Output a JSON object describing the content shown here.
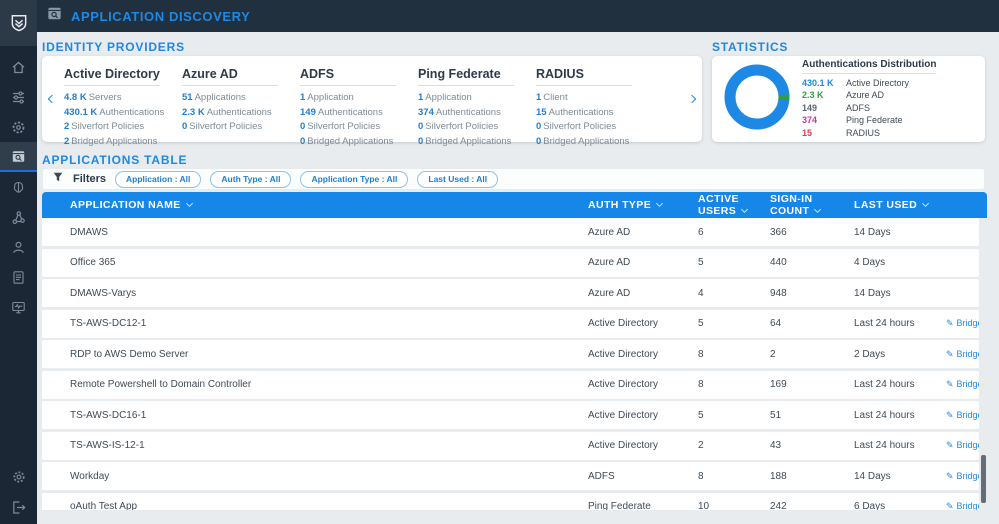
{
  "topbar": {
    "title": "APPLICATION DISCOVERY"
  },
  "sidebar": {
    "items": [
      {
        "icon": "home-icon"
      },
      {
        "icon": "policies-sliders-icon"
      },
      {
        "icon": "sync-gear-icon"
      },
      {
        "icon": "application-discovery-icon",
        "active": true
      },
      {
        "icon": "ai-brain-icon"
      },
      {
        "icon": "connections-graph-icon"
      },
      {
        "icon": "users-icon"
      },
      {
        "icon": "reports-document-icon"
      },
      {
        "icon": "monitoring-screen-icon"
      },
      {
        "icon": "settings-gear-icon"
      },
      {
        "icon": "logout-icon"
      }
    ]
  },
  "sections": {
    "identity_providers": "IDENTITY PROVIDERS",
    "statistics": "STATISTICS",
    "applications_table": "APPLICATIONS TABLE"
  },
  "providers": [
    {
      "name": "Active Directory",
      "stats": [
        {
          "value": "4.8 K",
          "label": "Servers"
        },
        {
          "value": "430.1 K",
          "label": "Authentications"
        },
        {
          "value": "2",
          "label": "Silverfort Policies"
        },
        {
          "value": "2",
          "label": "Bridged Applications"
        }
      ]
    },
    {
      "name": "Azure AD",
      "stats": [
        {
          "value": "51",
          "label": "Applications"
        },
        {
          "value": "2.3 K",
          "label": "Authentications"
        },
        {
          "value": "0",
          "label": "Silverfort Policies"
        }
      ]
    },
    {
      "name": "ADFS",
      "stats": [
        {
          "value": "1",
          "label": "Application"
        },
        {
          "value": "149",
          "label": "Authentications"
        },
        {
          "value": "0",
          "label": "Silverfort Policies"
        },
        {
          "value": "0",
          "label": "Bridged Applications"
        }
      ]
    },
    {
      "name": "Ping Federate",
      "stats": [
        {
          "value": "1",
          "label": "Application"
        },
        {
          "value": "374",
          "label": "Authentications"
        },
        {
          "value": "0",
          "label": "Silverfort Policies"
        },
        {
          "value": "0",
          "label": "Bridged Applications"
        }
      ]
    },
    {
      "name": "RADIUS",
      "stats": [
        {
          "value": "1",
          "label": "Client"
        },
        {
          "value": "15",
          "label": "Authentications"
        },
        {
          "value": "0",
          "label": "Silverfort Policies"
        },
        {
          "value": "0",
          "label": "Bridged Applications"
        }
      ]
    }
  ],
  "statistics": {
    "title": "Authentications Distribution",
    "legend": [
      {
        "value": "430.1 K",
        "label": "Active Directory",
        "color": "#1e88e5"
      },
      {
        "value": "2.3 K",
        "label": "Azure AD",
        "color": "#2f9e44"
      },
      {
        "value": "149",
        "label": "ADFS",
        "color": "#5a6470"
      },
      {
        "value": "374",
        "label": "Ping Federate",
        "color": "#c2399e"
      },
      {
        "value": "15",
        "label": "RADIUS",
        "color": "#d64550"
      }
    ]
  },
  "chart_data": {
    "type": "pie",
    "title": "Authentications Distribution",
    "categories": [
      "Active Directory",
      "Azure AD",
      "ADFS",
      "Ping Federate",
      "RADIUS"
    ],
    "values": [
      430100,
      2300,
      149,
      374,
      15
    ],
    "colors": [
      "#1e88e5",
      "#2f9e44",
      "#5a6470",
      "#c2399e",
      "#d64550"
    ],
    "legend_position": "right"
  },
  "filters": {
    "label": "Filters",
    "pills": [
      "Application : All",
      "Auth Type : All",
      "Application Type : All",
      "Last Used : All"
    ]
  },
  "table": {
    "columns": [
      "APPLICATION NAME",
      "AUTH TYPE",
      "ACTIVE USERS",
      "SIGN-IN COUNT",
      "LAST USED"
    ],
    "rows": [
      {
        "name": "DMAWS",
        "auth": "Azure AD",
        "users": "6",
        "signin": "366",
        "last": "14 Days",
        "bridge": ""
      },
      {
        "name": "Office 365",
        "auth": "Azure AD",
        "users": "5",
        "signin": "440",
        "last": "4 Days",
        "bridge": ""
      },
      {
        "name": "DMAWS-Varys",
        "auth": "Azure AD",
        "users": "4",
        "signin": "948",
        "last": "14 Days",
        "bridge": ""
      },
      {
        "name": "TS-AWS-DC12-1",
        "auth": "Active Directory",
        "users": "5",
        "signin": "64",
        "last": "Last 24 hours",
        "bridge": "Bridge to SSO"
      },
      {
        "name": "RDP to AWS Demo Server",
        "auth": "Active Directory",
        "users": "8",
        "signin": "2",
        "last": "2 Days",
        "bridge": "Bridge to SSO"
      },
      {
        "name": "Remote Powershell to Domain Controller",
        "auth": "Active Directory",
        "users": "8",
        "signin": "169",
        "last": "Last 24 hours",
        "bridge": "Bridge to SSO"
      },
      {
        "name": "TS-AWS-DC16-1",
        "auth": "Active Directory",
        "users": "5",
        "signin": "51",
        "last": "Last 24 hours",
        "bridge": "Bridge to SSO"
      },
      {
        "name": "TS-AWS-IS-12-1",
        "auth": "Active Directory",
        "users": "2",
        "signin": "43",
        "last": "Last 24 hours",
        "bridge": "Bridge to SSO"
      },
      {
        "name": "Workday",
        "auth": "ADFS",
        "users": "8",
        "signin": "188",
        "last": "14 Days",
        "bridge": "Bridge to SSO"
      },
      {
        "name": "oAuth Test App",
        "auth": "Ping Federate",
        "users": "10",
        "signin": "242",
        "last": "6 Days",
        "bridge": "Bridge to SSO"
      }
    ]
  },
  "colors": {
    "accent": "#1e88e5",
    "topbar_bg": "#20303f",
    "sidebar_bg": "#1b2734",
    "table_header_bg": "#1687e8",
    "page_bg": "#e9ecef",
    "donut_main": "#1e88e5",
    "donut_secondary": "#2f9e44"
  }
}
